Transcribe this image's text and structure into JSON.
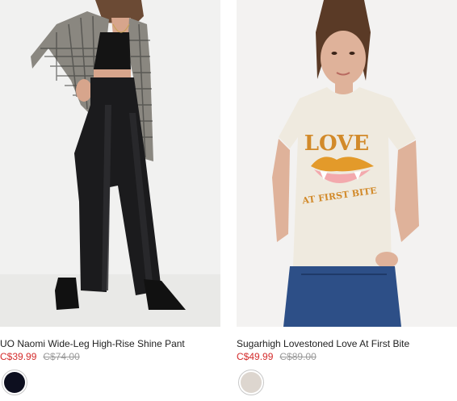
{
  "products": [
    {
      "name": "UO Naomi Wide-Leg High-Rise Shine Pant",
      "sale_price": "C$39.99",
      "original_price": "C$74.00",
      "image_alt": "Model wearing black wide-leg shine pants with a plaid blazer and black crop top",
      "swatches": [
        {
          "color_name": "Black",
          "hex": "#0d0f1f"
        }
      ]
    },
    {
      "name": "Sugarhigh Lovestoned Love At First Bite",
      "sale_price": "C$49.99",
      "original_price": "C$89.00",
      "image_alt": "Model wearing a cream graphic tee and blue jeans",
      "tee_graphic": {
        "line1": "LOVE",
        "line2": "AT FIRST BITE"
      },
      "swatches": [
        {
          "color_name": "Cream",
          "hex": "#ddd6cf"
        }
      ]
    }
  ],
  "colors": {
    "sale_price": "#d42b2b",
    "original_price": "#9a9a9a",
    "product_name": "#1f1f1f",
    "image_bg": "#f1f1f0"
  }
}
